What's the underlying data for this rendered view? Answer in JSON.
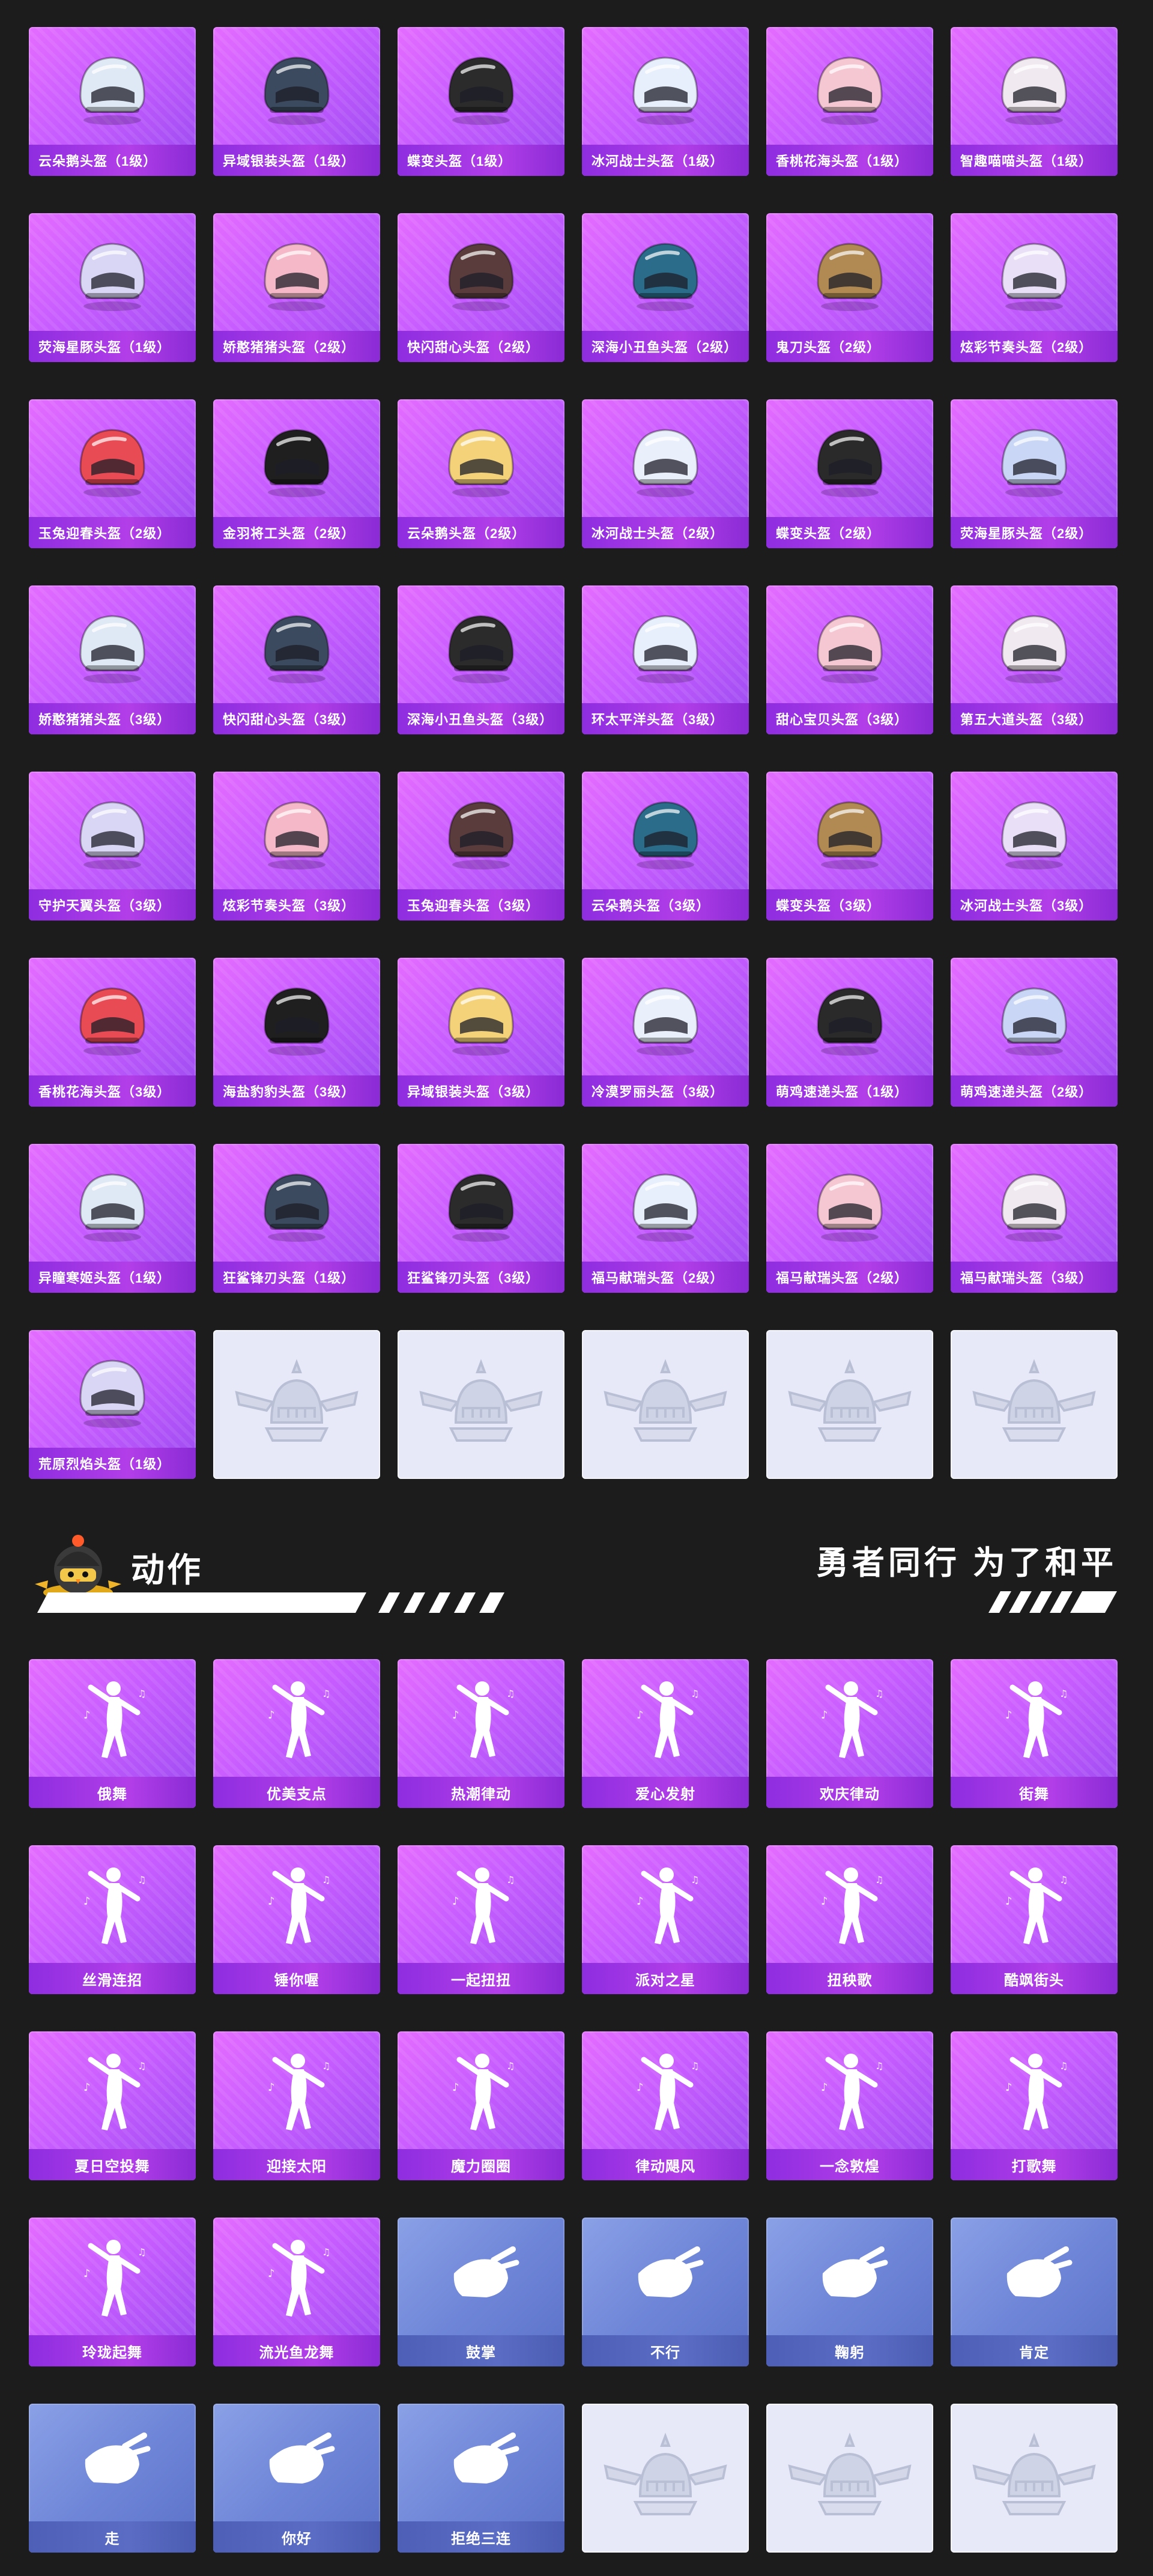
{
  "helmets": [
    "云朵鹅头盔（1级）",
    "异域银装头盔（1级）",
    "蝶变头盔（1级）",
    "冰河战士头盔（1级）",
    "香桃花海头盔（1级）",
    "智趣喵喵头盔（1级）",
    "荧海星豚头盔（1级）",
    "娇憨猪猪头盔（2级）",
    "快闪甜心头盔（2级）",
    "深海小丑鱼头盔（2级）",
    "鬼刀头盔（2级）",
    "炫彩节奏头盔（2级）",
    "玉兔迎春头盔（2级）",
    "金羽将工头盔（2级）",
    "云朵鹅头盔（2级）",
    "冰河战士头盔（2级）",
    "蝶变头盔（2级）",
    "荧海星豚头盔（2级）",
    "娇憨猪猪头盔（3级）",
    "快闪甜心头盔（3级）",
    "深海小丑鱼头盔（3级）",
    "环太平洋头盔（3级）",
    "甜心宝贝头盔（3级）",
    "第五大道头盔（3级）",
    "守护天翼头盔（3级）",
    "炫彩节奏头盔（3级）",
    "玉兔迎春头盔（3级）",
    "云朵鹅头盔（3级）",
    "蝶变头盔（3级）",
    "冰河战士头盔（3级）",
    "香桃花海头盔（3级）",
    "海盐豹豹头盔（3级）",
    "异域银装头盔（3级）",
    "冷漠罗丽头盔（3级）",
    "萌鸡速递头盔（1级）",
    "萌鸡速递头盔（2级）",
    "异瞳寒姬头盔（1级）",
    "狂鲨锋刃头盔（1级）",
    "狂鲨锋刃头盔（3级）",
    "福马献瑞头盔（2级）",
    "福马献瑞头盔（2级）",
    "福马献瑞头盔（3级）",
    "荒原烈焰头盔（1级）"
  ],
  "section": {
    "title": "动作",
    "slogan": "勇者同行 为了和平"
  },
  "emotes_purple": [
    "俄舞",
    "优美支点",
    "热潮律动",
    "爱心发射",
    "欢庆律动",
    "街舞",
    "丝滑连招",
    "锤你喔",
    "一起扭扭",
    "派对之星",
    "扭秧歌",
    "酷飒街头",
    "夏日空投舞",
    "迎接太阳",
    "魔力圈圈",
    "律动飓风",
    "一念敦煌",
    "打歌舞",
    "玲珑起舞",
    "流光鱼龙舞"
  ],
  "emotes_blue": [
    "鼓掌",
    "不行",
    "鞠躬",
    "肯定",
    "走",
    "你好",
    "拒绝三连"
  ],
  "colors": {
    "background": "#1c1c1c",
    "card_purple": "#c65cff",
    "card_blue": "#6f86d8",
    "card_empty": "#e7e9f8",
    "label_purple": "#9a33e0"
  },
  "icons": {
    "helmet": "helmet-icon",
    "emote": "dancer-silhouette-icon",
    "placeholder": "winged-helmet-emblem-icon",
    "mascot": "chick-mascot-icon"
  }
}
